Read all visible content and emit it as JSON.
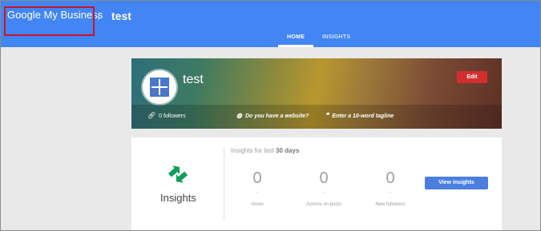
{
  "header": {
    "brand": "Google My Business",
    "separator": "›",
    "breadcrumb": "test",
    "tabs": [
      {
        "label": "HOME",
        "active": true
      },
      {
        "label": "INSIGHTS",
        "active": false
      }
    ],
    "color": "#4285f4"
  },
  "cover": {
    "business_name": "test",
    "edit_label": "Edit",
    "followers": "0 followers",
    "website_prompt": "Do you have a website?",
    "tagline_prompt": "Enter a 10-word tagline"
  },
  "insights": {
    "title": "Insights",
    "period_prefix": "Insights for last",
    "period": "30 days",
    "stats": [
      {
        "value": "0",
        "change": "-",
        "label": "Views"
      },
      {
        "value": "0",
        "change": "-",
        "label": "Actions on posts"
      },
      {
        "value": "0",
        "change": "-",
        "label": "New followers"
      }
    ],
    "button_label": "View insights"
  },
  "icons": {
    "avatar": "store-tile-icon",
    "followers": "link-icon",
    "website": "globe-icon",
    "tagline": "quote-icon",
    "insights": "swap-arrows-icon"
  },
  "colors": {
    "accent": "#4285f4",
    "edit_button": "#d32f2f",
    "insights_icon": "#0f9d58",
    "highlight_box": "#c9142a"
  }
}
